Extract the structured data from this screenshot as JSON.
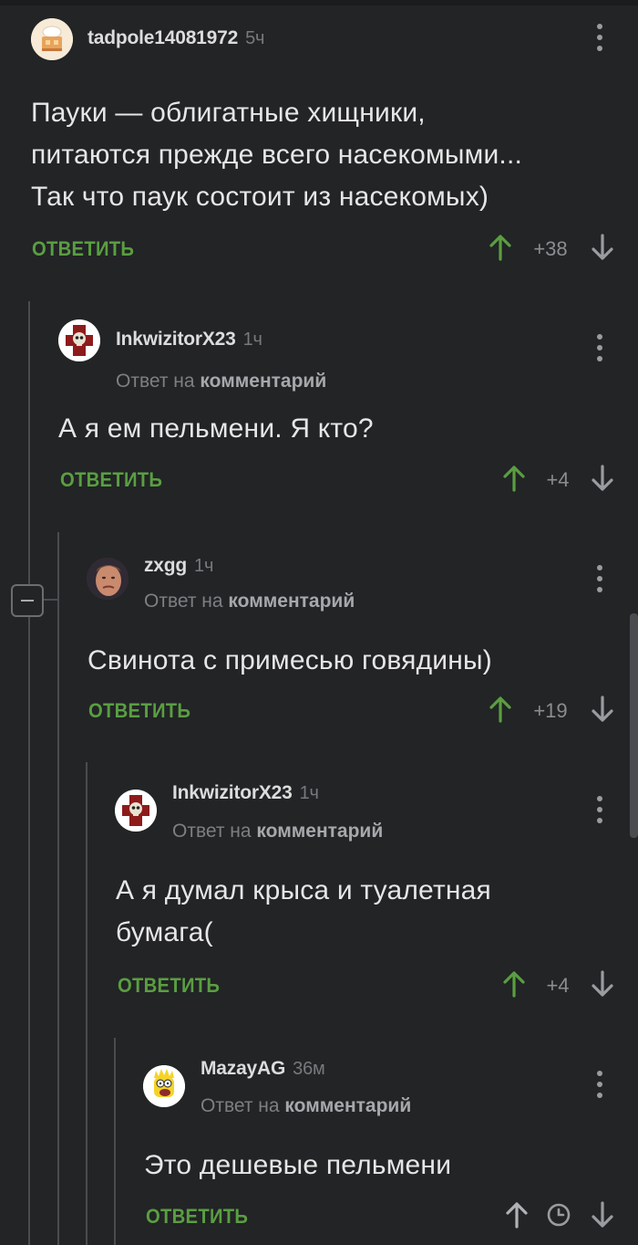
{
  "comments": [
    {
      "username": "tadpole14081972",
      "time": "5ч",
      "reply_prefix": "",
      "reply_target": "",
      "text": "Пауки — облигатные хищники,\nпитаются прежде всего насекомыми...\nТак что паук состоит из насекомых)",
      "reply_label": "ОТВЕТИТЬ",
      "score": "+38",
      "avatar": "bakery-avatar",
      "vote_color": "#5a9e41"
    },
    {
      "username": "InkwizitorX23",
      "time": "1ч",
      "reply_prefix": "Ответ на ",
      "reply_target": "комментарий",
      "text": "А я ем пельмени. Я кто?",
      "reply_label": "ОТВЕТИТЬ",
      "score": "+4",
      "avatar": "inquisitor-skull-avatar",
      "vote_color": "#5a9e41"
    },
    {
      "username": "zxgg",
      "time": "1ч",
      "reply_prefix": "Ответ на ",
      "reply_target": "комментарий",
      "text": "Свинота с примесью говядины)",
      "reply_label": "ОТВЕТИТЬ",
      "score": "+19",
      "avatar": "man-face-avatar",
      "vote_color": "#5a9e41"
    },
    {
      "username": "InkwizitorX23",
      "time": "1ч",
      "reply_prefix": "Ответ на ",
      "reply_target": "комментарий",
      "text": "А я думал крыса и туалетная\nбумага(",
      "reply_label": "ОТВЕТИТЬ",
      "score": "+4",
      "avatar": "inquisitor-skull-avatar",
      "vote_color": "#5a9e41"
    },
    {
      "username": "MazayAG",
      "time": "36м",
      "reply_prefix": "Ответ на ",
      "reply_target": "комментарий",
      "text": "Это дешевые пельмени",
      "reply_label": "ОТВЕТИТЬ",
      "score": "",
      "avatar": "simpson-avatar",
      "vote_color": "#b0b2b5"
    }
  ],
  "icons": {
    "upvote": "arrow-up-icon",
    "downvote": "arrow-down-icon",
    "menu": "more-vertical-icon",
    "pending": "clock-icon",
    "collapse": "minus-icon"
  },
  "colors": {
    "background": "#222426",
    "accent_green": "#5a9e41",
    "text": "#e6e6e6",
    "muted": "#7d7f82"
  }
}
